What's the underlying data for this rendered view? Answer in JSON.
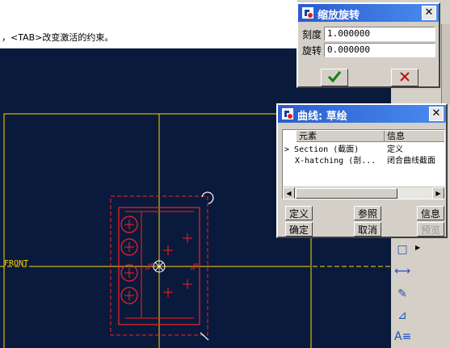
{
  "message": {
    "text": "，<TAB>改变激活的约束。"
  },
  "canvas": {
    "background": "#0a1a3c",
    "datum_label": "FRONT",
    "datum_color": "#ffd700",
    "sketch_color": "#ff2020"
  },
  "scale_rotate_dialog": {
    "title": "缩放旋转",
    "scale_label": "刻度",
    "scale_value": "1.000000",
    "rotate_label": "旋转",
    "rotate_value": "0.000000",
    "ok_icon": "checkmark-icon",
    "cancel_icon": "cross-icon"
  },
  "curve_dialog": {
    "title": "曲线: 草绘",
    "columns": [
      "元素",
      "信息"
    ],
    "rows": [
      {
        "element": "Section (截面)",
        "info": "定义"
      },
      {
        "element": "X-hatching (剖...",
        "info": "闭合曲线截面"
      }
    ],
    "buttons": {
      "define": "定义",
      "reference": "参照",
      "info": "信息",
      "confirm": "确定",
      "cancel": "取消",
      "preview": "预览"
    }
  },
  "right_toolbar": {
    "icons": [
      "square-icon",
      "dimension-icon",
      "edit-dimension-icon",
      "modify-icon",
      "text-icon"
    ]
  }
}
